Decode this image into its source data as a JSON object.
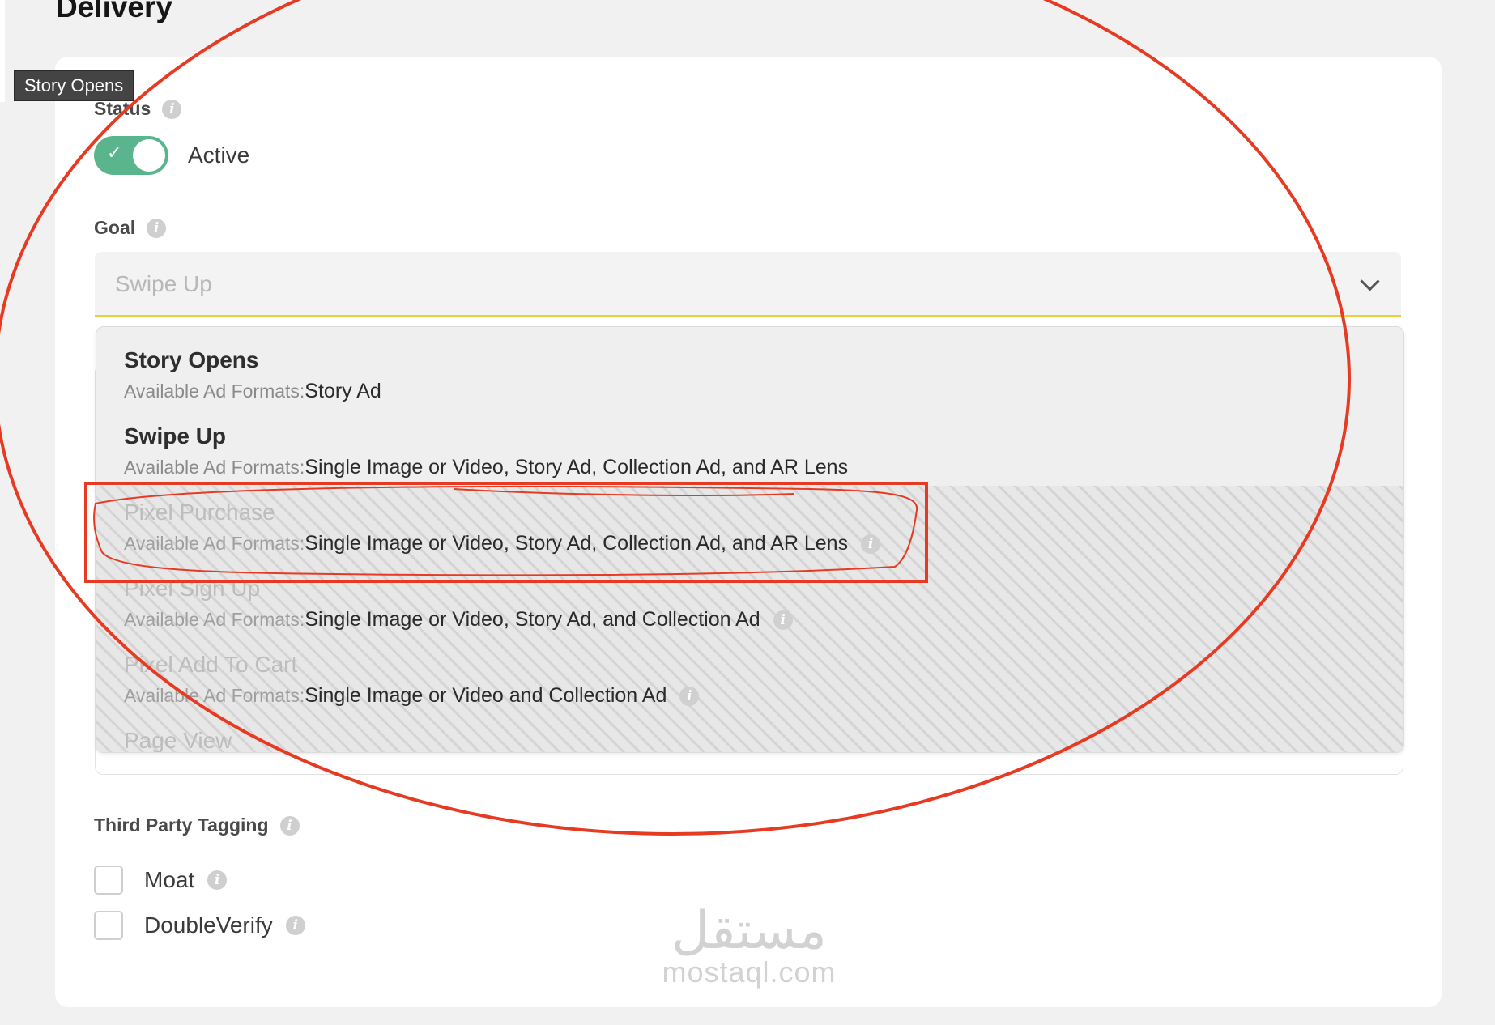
{
  "page": {
    "title": "Delivery",
    "tooltip": "Story Opens"
  },
  "status": {
    "label": "Status",
    "toggle_state": "Active"
  },
  "goal": {
    "label": "Goal",
    "selected": "Swipe Up",
    "options": [
      {
        "name": "Story Opens",
        "formats_label": "Available Ad Formats:",
        "formats": "Story Ad"
      },
      {
        "name": "Swipe Up",
        "formats_label": "Available Ad Formats:",
        "formats": "Single Image or Video, Story Ad, Collection Ad, and AR Lens"
      },
      {
        "name": "Pixel Purchase",
        "formats_label": "Available Ad Formats:",
        "formats": "Single Image or Video, Story Ad, Collection Ad, and AR Lens"
      },
      {
        "name": "Pixel Sign Up",
        "formats_label": "Available Ad Formats:",
        "formats": "Single Image or Video, Story Ad, and Collection Ad"
      },
      {
        "name": "Pixel Add To Cart",
        "formats_label": "Available Ad Formats:",
        "formats": "Single Image or Video and Collection Ad"
      },
      {
        "name": "Page View"
      }
    ]
  },
  "third_party": {
    "label": "Third Party Tagging",
    "options": [
      "Moat",
      "DoubleVerify"
    ]
  },
  "watermark": {
    "arabic": "مستقل",
    "latin": "mostaql.com"
  },
  "colors": {
    "toggle_on": "#5bb58c",
    "select_underline": "#f2cd3b",
    "annotation": "#e63b22"
  },
  "icons": {
    "info": "info-icon",
    "dropdown": "chevron-down-icon",
    "toggle_check": "check-icon"
  }
}
